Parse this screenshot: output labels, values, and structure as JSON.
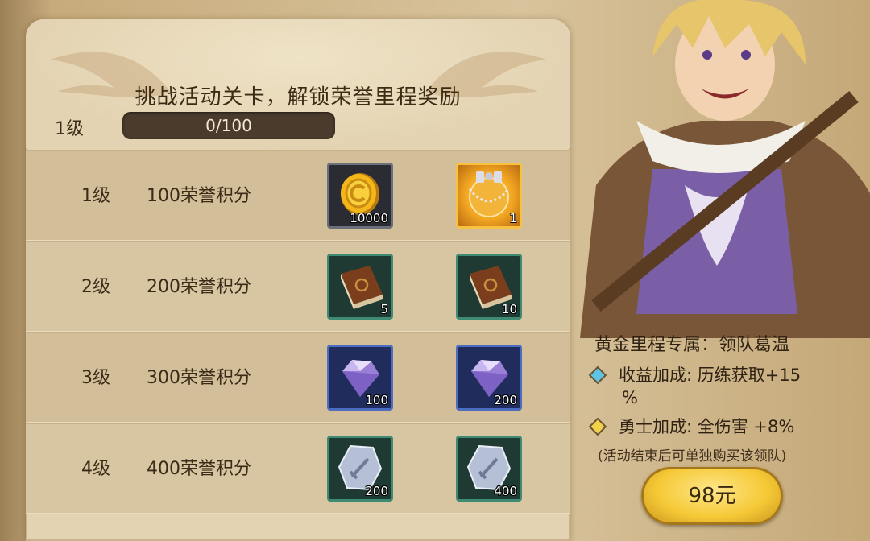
{
  "title": "挑战活动关卡，解锁荣誉里程奖励",
  "current_level": "1级",
  "progress": {
    "text": "0/100",
    "fraction": 0.0
  },
  "rows": [
    {
      "level": "1级",
      "points": "100荣誉积分",
      "rewards": [
        {
          "icon": "gold-coin-icon",
          "qty": "10000"
        },
        {
          "icon": "necklace-icon",
          "qty": "1"
        }
      ]
    },
    {
      "level": "2级",
      "points": "200荣誉积分",
      "rewards": [
        {
          "icon": "book-icon",
          "qty": "5"
        },
        {
          "icon": "book-icon",
          "qty": "10"
        }
      ]
    },
    {
      "level": "3级",
      "points": "300荣誉积分",
      "rewards": [
        {
          "icon": "diamond-icon",
          "qty": "100"
        },
        {
          "icon": "diamond-icon",
          "qty": "200"
        }
      ]
    },
    {
      "level": "4级",
      "points": "400荣誉积分",
      "rewards": [
        {
          "icon": "sword-token-icon",
          "qty": "200"
        },
        {
          "icon": "sword-token-icon",
          "qty": "400"
        }
      ]
    }
  ],
  "hero": {
    "exclusive": "黄金里程专属：领队葛温",
    "bonus1_line1": "收益加成: 历练获取+15",
    "bonus1_line2": "%",
    "bonus2": "勇士加成: 全伤害 +8%",
    "note": "(活动结束后可单独购买该领队)"
  },
  "buy_button": "98元",
  "colors": {
    "panel": "#e3d3b2",
    "progress_bar": "#4b3b2c",
    "button_gold": "#f5c936"
  }
}
